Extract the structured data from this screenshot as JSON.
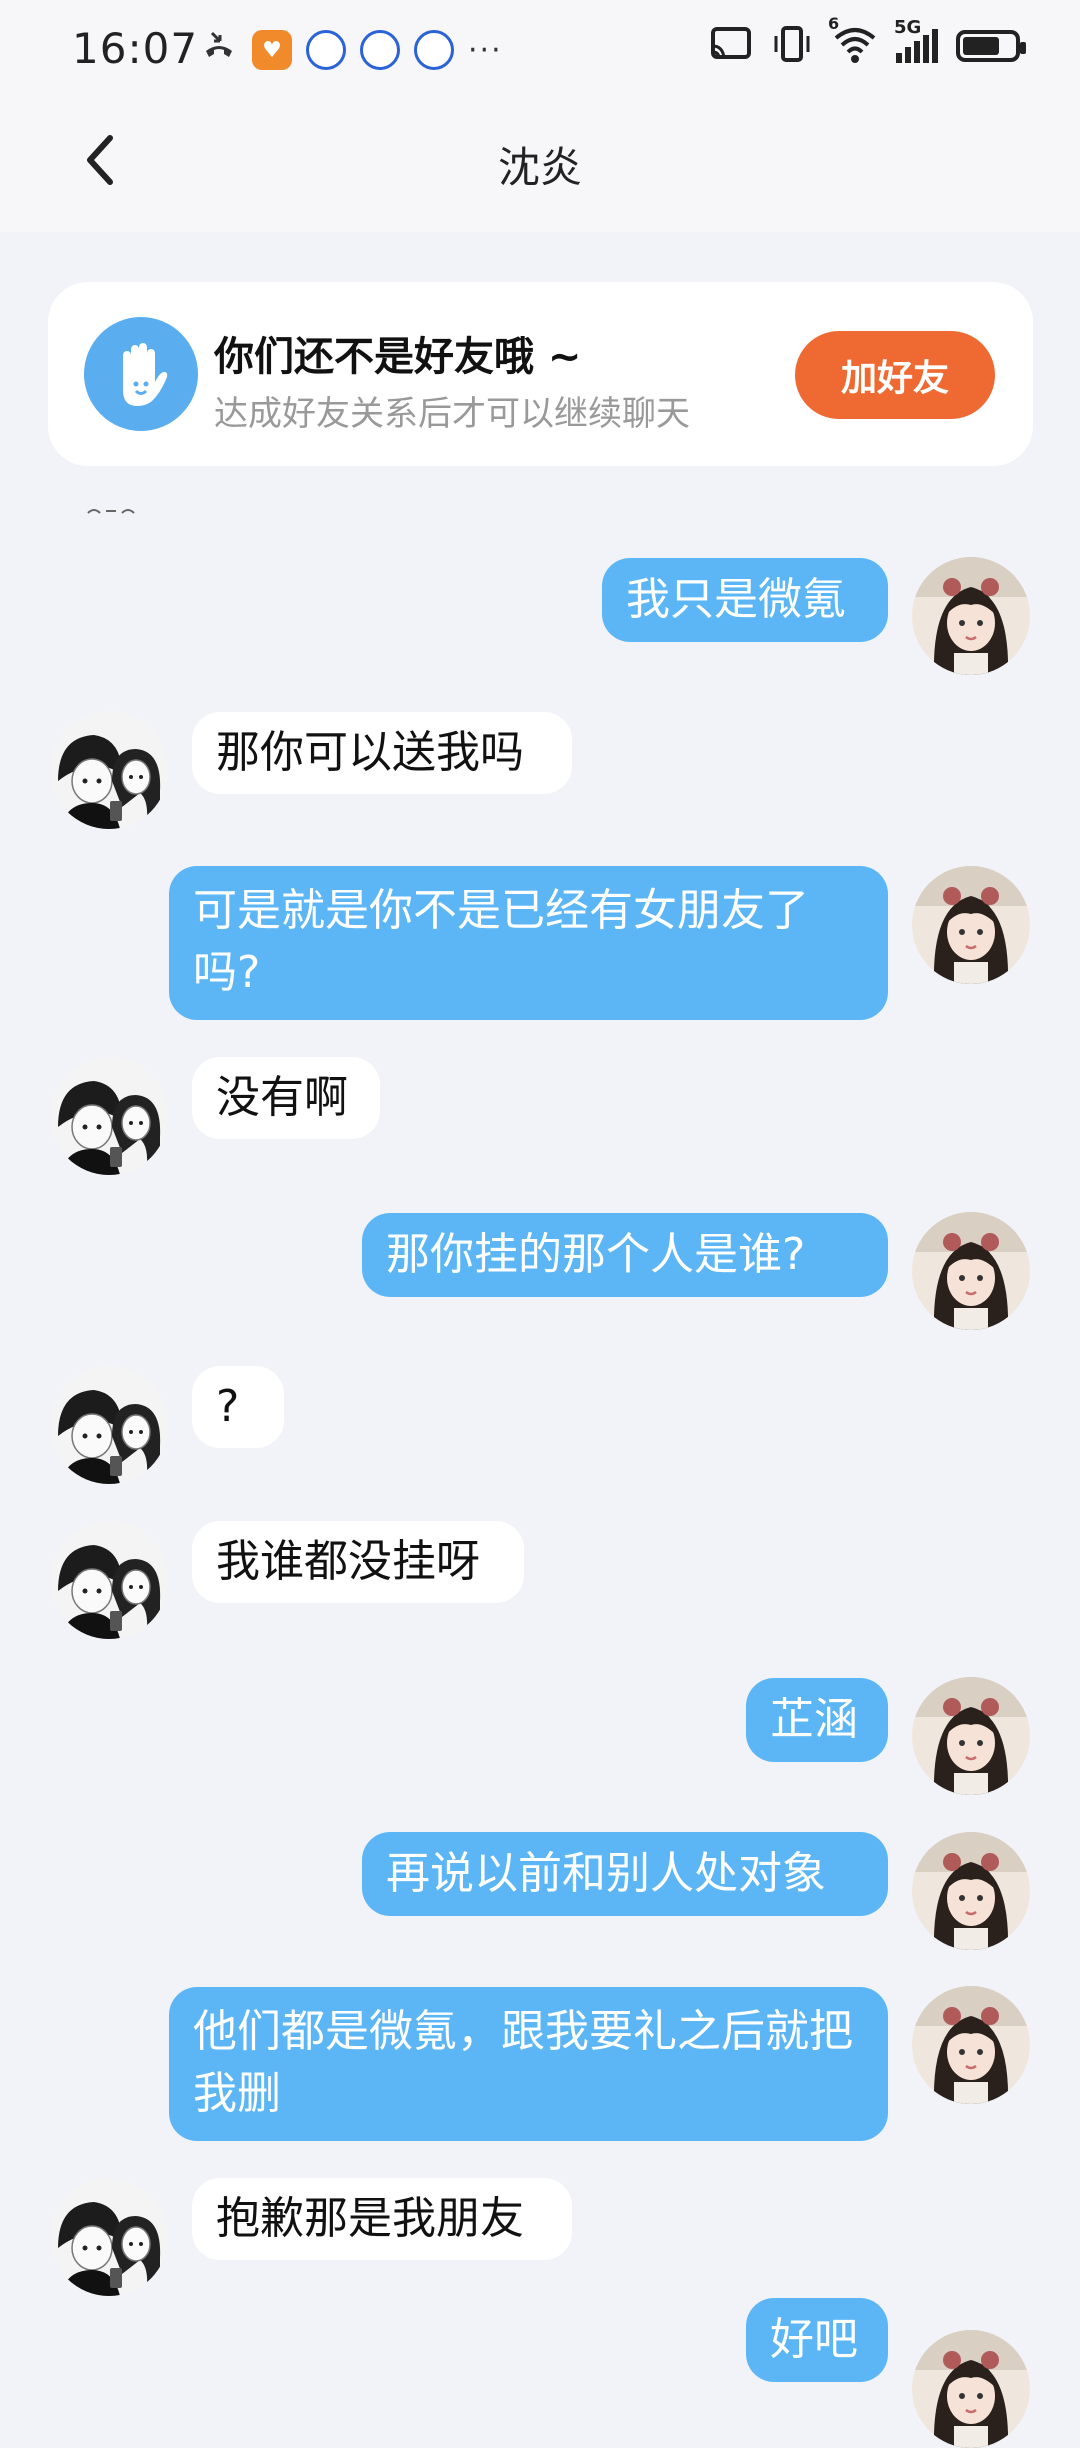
{
  "status_bar": {
    "time": "16:07",
    "network": "5G",
    "wifi_badge": "6",
    "more": "···"
  },
  "header": {
    "title": "沈炎"
  },
  "friend_card": {
    "title": "你们还不是好友哦 ~",
    "subtitle": "达成好友关系后才可以继续聊天",
    "button": "加好友"
  },
  "messages": [
    {
      "from": "me",
      "text": "我只是微氪"
    },
    {
      "from": "them",
      "text": "那你可以送我吗"
    },
    {
      "from": "me",
      "text": "可是就是你不是已经有女朋友了吗?"
    },
    {
      "from": "them",
      "text": "没有啊"
    },
    {
      "from": "me",
      "text": "那你挂的那个人是谁?"
    },
    {
      "from": "them",
      "text": "?"
    },
    {
      "from": "them",
      "text": "我谁都没挂呀"
    },
    {
      "from": "me",
      "text": "芷涵"
    },
    {
      "from": "me",
      "text": "再说以前和别人处对象"
    },
    {
      "from": "me",
      "text": "他们都是微氪，跟我要礼之后就把我删"
    },
    {
      "from": "them",
      "text": "抱歉那是我朋友"
    },
    {
      "from": "me",
      "text": "好吧"
    }
  ],
  "colors": {
    "my_bubble": "#5cb6f5",
    "their_bubble": "#ffffff",
    "add_button": "#ef6a33",
    "background": "#f1f3f9"
  }
}
